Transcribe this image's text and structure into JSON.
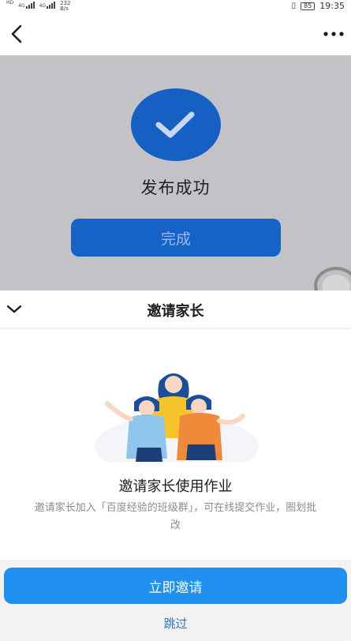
{
  "status_bar": {
    "network_tags": [
      "HD",
      "4G",
      "4G"
    ],
    "speed_value": "232",
    "speed_unit": "B/s",
    "battery": "85",
    "time": "19:35"
  },
  "top_bar": {
    "back_icon": "chevron-left-icon",
    "more_icon": "more-dots-icon"
  },
  "publish": {
    "success_icon": "check-icon",
    "title": "发布成功",
    "done_label": "完成"
  },
  "sheet": {
    "collapse_icon": "chevron-down-icon",
    "title": "邀请家长",
    "heading": "邀请家长使用作业",
    "description": "邀请家长加入「百度经验的班级群」，可在线提交作业，圈划批改",
    "invite_label": "立即邀请",
    "skip_label": "跳过"
  },
  "colors": {
    "accent": "#1f8ff0",
    "success": "#1660c4",
    "overlay": "#c3c3c7"
  }
}
